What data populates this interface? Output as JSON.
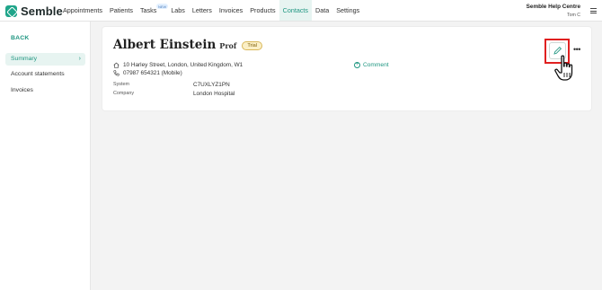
{
  "brand": {
    "name": "Semble"
  },
  "nav": {
    "items": [
      {
        "label": "Appointments"
      },
      {
        "label": "Patients"
      },
      {
        "label": "Tasks",
        "badge": "NEW"
      },
      {
        "label": "Labs"
      },
      {
        "label": "Letters"
      },
      {
        "label": "Invoices"
      },
      {
        "label": "Products"
      },
      {
        "label": "Contacts",
        "active": true
      },
      {
        "label": "Data"
      },
      {
        "label": "Settings"
      }
    ]
  },
  "help": {
    "title": "Semble Help Centre",
    "user": "Tom C"
  },
  "sidebar": {
    "back_label": "BACK",
    "items": [
      {
        "label": "Summary",
        "active": true
      },
      {
        "label": "Account statements"
      },
      {
        "label": "Invoices"
      }
    ]
  },
  "contact": {
    "name": "Albert Einstein",
    "title": "Prof",
    "status_badge": "Trial",
    "address": "10 Harley Street, London, United Kingdom, W1",
    "phone": "07987 654321 (Mobile)",
    "system_label": "System",
    "system_value": "C7UXLYZ1PN",
    "company_label": "Company",
    "company_value": "London Hospital",
    "comment_label": "Comment"
  },
  "icons": {
    "home": "home-icon",
    "phone": "phone-icon",
    "edit": "pencil-icon",
    "more": "more-horizontal-icon",
    "comment": "plus-circle-icon",
    "cursor": "hand-pointer-icon"
  },
  "colors": {
    "accent": "#1f9681",
    "highlight": "#e02020",
    "trial_bg": "#fbefc6"
  }
}
